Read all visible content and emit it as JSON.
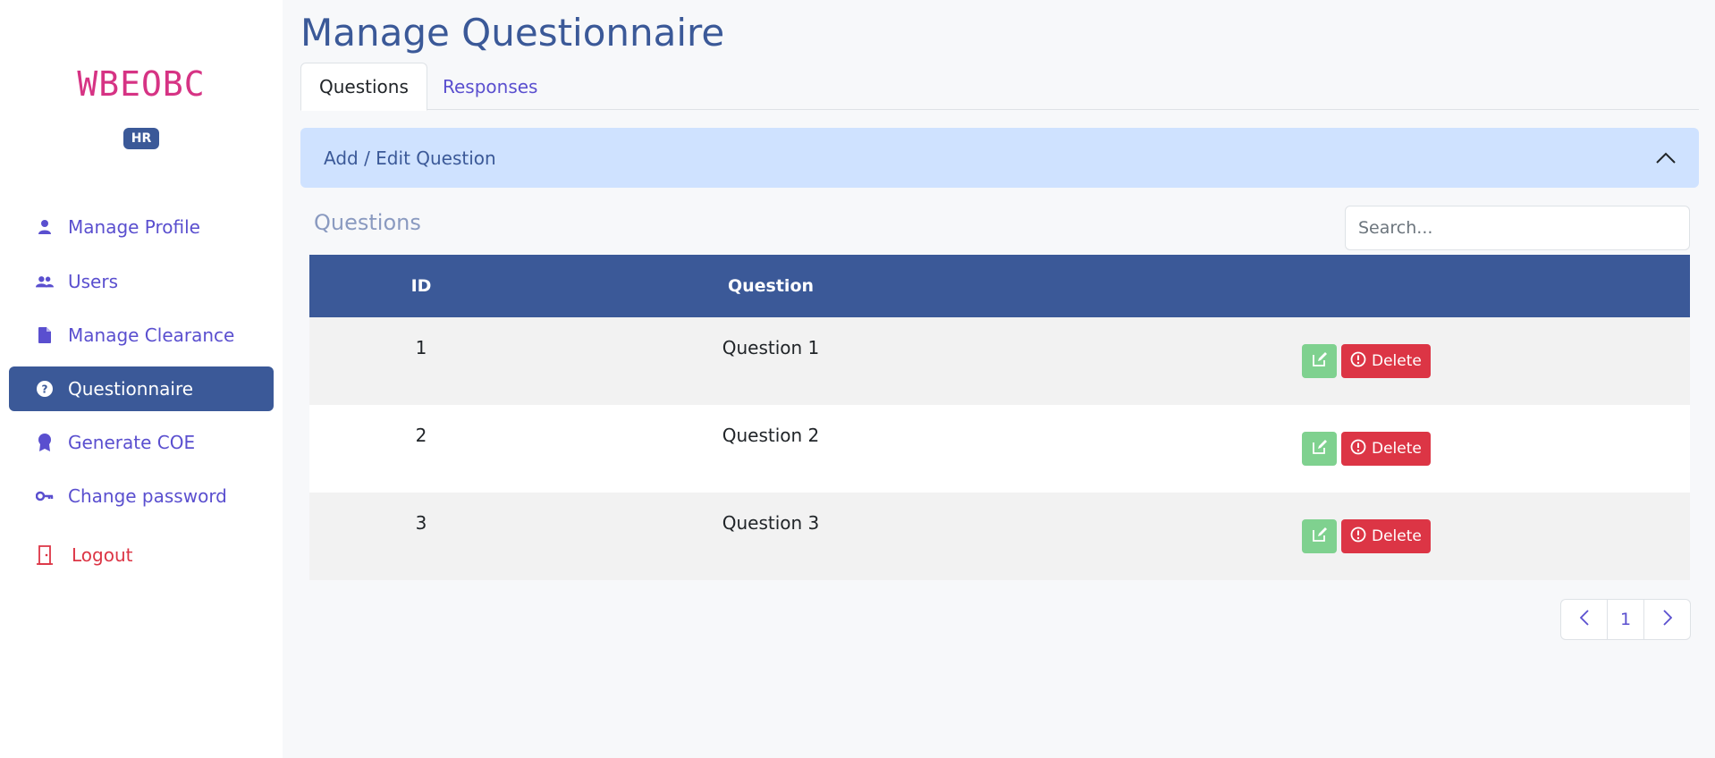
{
  "sidebar": {
    "brand": "WBEOBC",
    "role_badge": "HR",
    "items": [
      {
        "label": "Manage Profile",
        "icon": "person-icon"
      },
      {
        "label": "Users",
        "icon": "users-icon"
      },
      {
        "label": "Manage Clearance",
        "icon": "document-icon"
      },
      {
        "label": "Questionnaire",
        "icon": "question-circle-icon",
        "active": true
      },
      {
        "label": "Generate COE",
        "icon": "award-icon"
      },
      {
        "label": "Change password",
        "icon": "key-icon"
      },
      {
        "label": "Logout",
        "icon": "door-icon"
      }
    ]
  },
  "page": {
    "title": "Manage Questionnaire",
    "tabs": [
      {
        "label": "Questions",
        "active": true
      },
      {
        "label": "Responses",
        "active": false
      }
    ],
    "accordion_label": "Add / Edit Question",
    "section_title": "Questions",
    "search_placeholder": "Search..."
  },
  "table": {
    "headers": [
      "ID",
      "Question"
    ],
    "rows": [
      {
        "id": "1",
        "question": "Question 1"
      },
      {
        "id": "2",
        "question": "Question 2"
      },
      {
        "id": "3",
        "question": "Question 3"
      }
    ],
    "delete_label": "Delete"
  },
  "pagination": {
    "current_page": "1"
  },
  "colors": {
    "primary": "#3b5998",
    "brand": "#d63384",
    "danger": "#dc3545",
    "edit": "#7fd18f",
    "link": "#5a4fcf"
  }
}
